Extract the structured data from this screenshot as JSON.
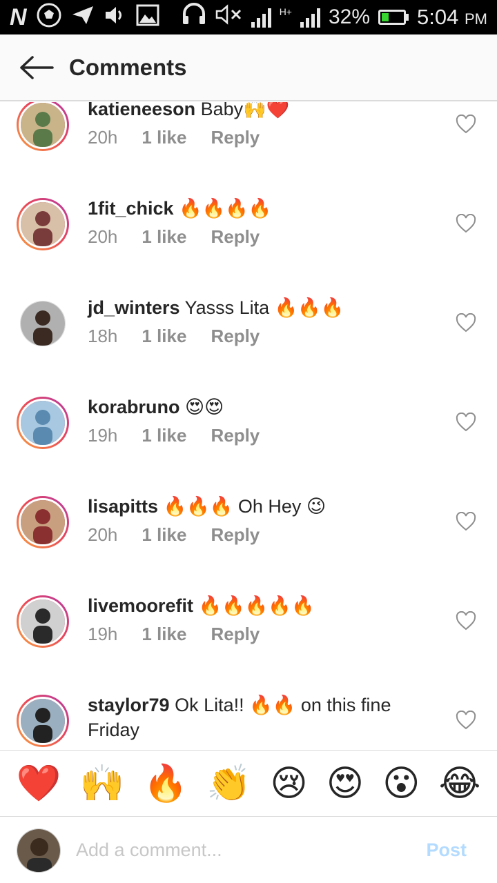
{
  "status_bar": {
    "left_icons": [
      "n-notification-icon",
      "soccer-ball-icon",
      "send-icon",
      "volume-icon",
      "image-icon"
    ],
    "headset_icon": "headset-icon",
    "mute_icon": "mute-icon",
    "network_type": "H+",
    "battery_percent": "32%",
    "battery_level": 0.32,
    "time": "5:04",
    "time_suffix": "PM"
  },
  "header": {
    "title": "Comments",
    "back_icon": "arrow-left-icon"
  },
  "comments": [
    {
      "username": "katieneeson",
      "text": "Baby🙌❤️",
      "time": "20h",
      "likes": "1 like",
      "reply": "Reply",
      "ring": true
    },
    {
      "username": "1fit_chick",
      "text": "🔥🔥🔥🔥",
      "time": "20h",
      "likes": "1 like",
      "reply": "Reply",
      "ring": true
    },
    {
      "username": "jd_winters",
      "text": "Yasss Lita 🔥🔥🔥",
      "time": "18h",
      "likes": "1 like",
      "reply": "Reply",
      "ring": false
    },
    {
      "username": "korabruno",
      "text": "😍😍",
      "time": "19h",
      "likes": "1 like",
      "reply": "Reply",
      "ring": true
    },
    {
      "username": "lisapitts",
      "text": "🔥🔥🔥 Oh Hey 😉",
      "time": "20h",
      "likes": "1 like",
      "reply": "Reply",
      "ring": true
    },
    {
      "username": "livemoorefit",
      "text": "🔥🔥🔥🔥🔥",
      "time": "19h",
      "likes": "1 like",
      "reply": "Reply",
      "ring": true
    },
    {
      "username": "staylor79",
      "text": "Ok Lita!! 🔥🔥 on this fine Friday",
      "time": "",
      "likes": "",
      "reply": "",
      "ring": true
    }
  ],
  "emoji_bar": [
    "❤️",
    "🙌",
    "🔥",
    "👏",
    "😢",
    "😍",
    "😮",
    "😂"
  ],
  "composer": {
    "placeholder": "Add a comment...",
    "post_label": "Post"
  }
}
